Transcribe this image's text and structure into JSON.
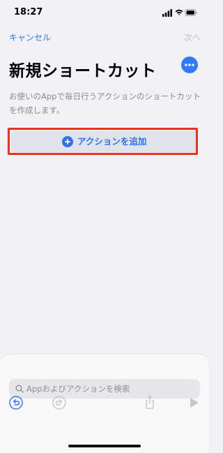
{
  "status_bar": {
    "time": "18:27"
  },
  "nav": {
    "cancel_label": "キャンセル",
    "next_label": "次へ"
  },
  "header": {
    "title": "新規ショートカット"
  },
  "description": "お使いのAppで毎日行うアクションのショートカットを作成します。",
  "add_action": {
    "label": "アクションを追加"
  },
  "search": {
    "placeholder": "Appおよびアクションを検索"
  },
  "toolbar": {
    "undo_icon": "undo-icon",
    "redo_icon": "redo-icon",
    "share_icon": "share-icon",
    "play_icon": "play-icon"
  },
  "colors": {
    "accent": "#3478f6",
    "highlight_frame": "#f0301c",
    "background": "#f2f1f6"
  }
}
